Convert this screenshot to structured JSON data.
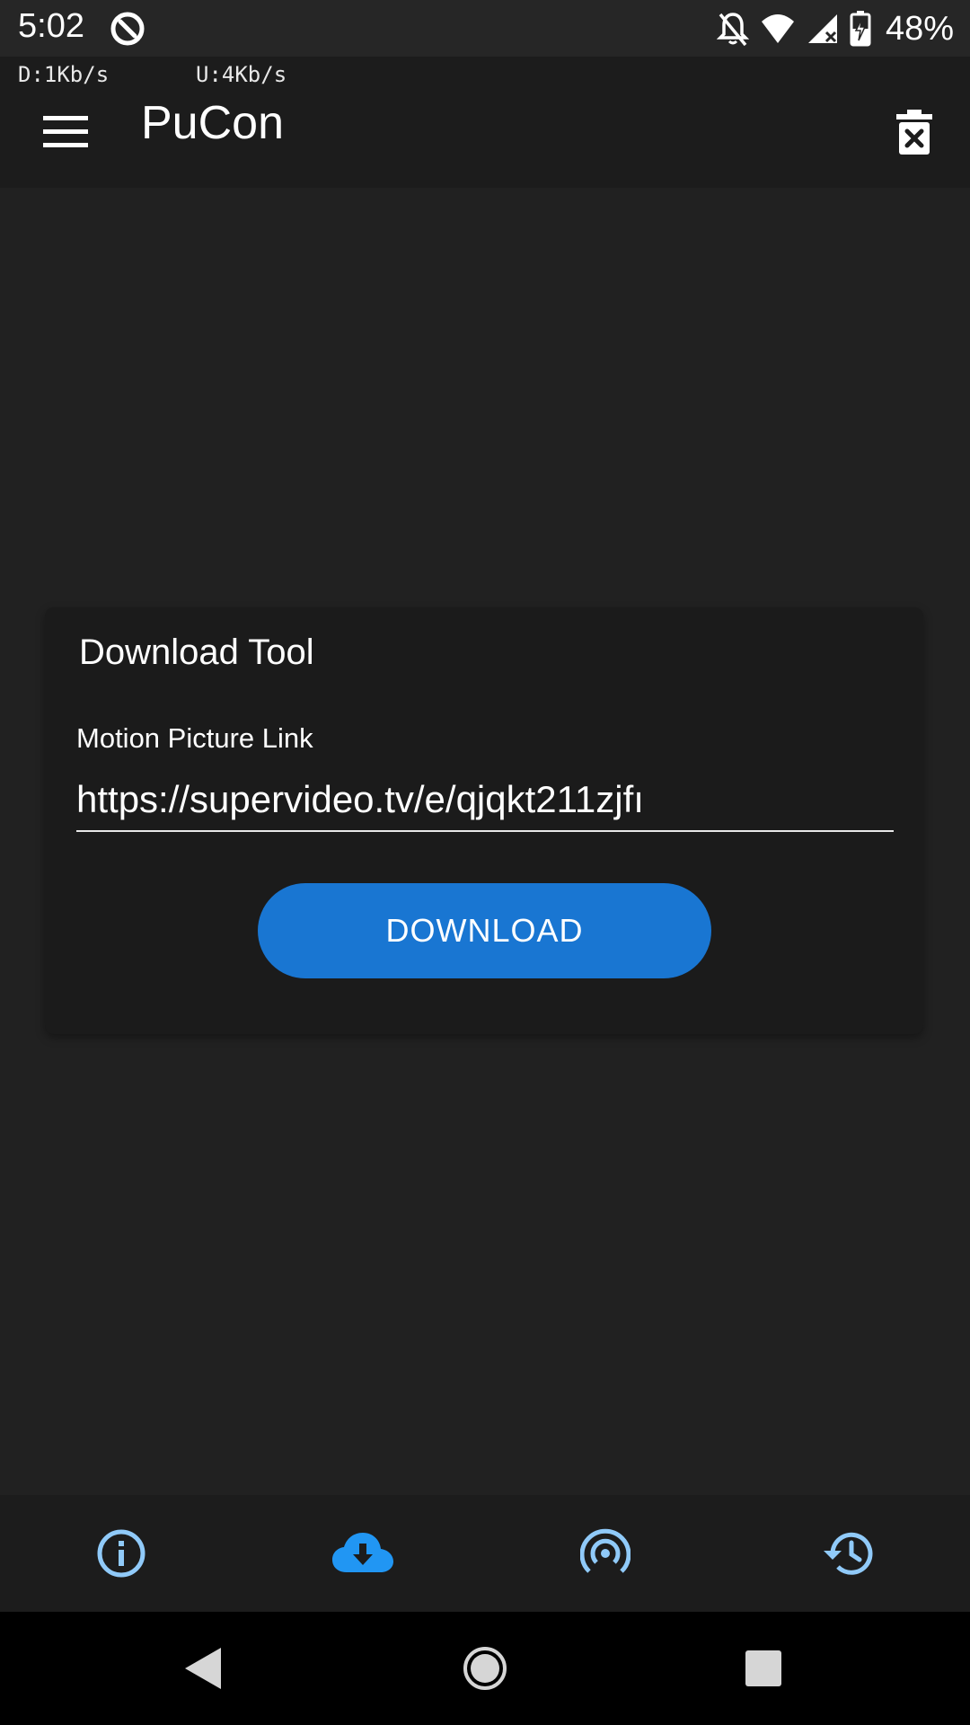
{
  "status_bar": {
    "time": "5:02",
    "battery": "48%",
    "icons": [
      "app-notification-icon",
      "notifications-off-icon",
      "wifi-icon",
      "cell-signal-icon",
      "battery-charging-icon"
    ]
  },
  "speed": {
    "download": "D:1Kb/s",
    "upload": "U:4Kb/s"
  },
  "app_bar": {
    "title": "PuCon",
    "menu_icon": "menu-icon",
    "delete_icon": "delete-icon"
  },
  "card": {
    "title": "Download Tool",
    "field_label": "Motion Picture Link",
    "url_value": "https://supervideo.tv/e/qjqkt211zjfı",
    "button_label": "DOWNLOAD"
  },
  "bottom_nav": {
    "items": [
      {
        "icon": "info-icon"
      },
      {
        "icon": "cloud-download-icon",
        "selected": true
      },
      {
        "icon": "broadcast-icon"
      },
      {
        "icon": "history-icon"
      }
    ],
    "accent_color": "#2196f3",
    "inactive_color": "#90caf9"
  },
  "system_nav": {
    "icons": [
      "back-icon",
      "home-icon",
      "recents-icon"
    ]
  },
  "colors": {
    "background": "#212121",
    "card": "#1b1b1b",
    "button": "#1976d2"
  }
}
